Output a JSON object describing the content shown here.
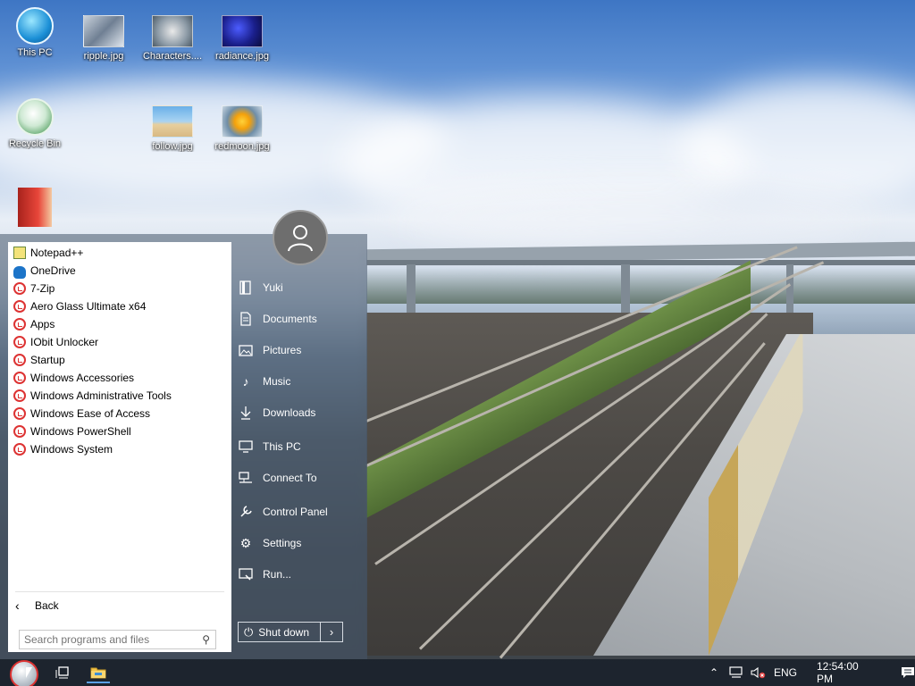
{
  "desktop": {
    "icons": [
      {
        "label": "This PC",
        "icon": "computer-icon"
      },
      {
        "label": "ripple.jpg",
        "icon": "image-file-icon"
      },
      {
        "label": "Characters....",
        "icon": "image-file-icon"
      },
      {
        "label": "radiance.jpg",
        "icon": "image-file-icon"
      },
      {
        "label": "Recycle Bin",
        "icon": "recycle-bin-icon"
      },
      {
        "label": "follow.jpg",
        "icon": "image-file-icon"
      },
      {
        "label": "redmoon.jpg",
        "icon": "image-file-icon"
      },
      {
        "label": "",
        "icon": "book-application-icon"
      }
    ]
  },
  "start_menu": {
    "programs": [
      {
        "label": "Notepad++",
        "icon": "notepad-icon"
      },
      {
        "label": "OneDrive",
        "icon": "onedrive-cloud-icon"
      },
      {
        "label": "7-Zip",
        "icon": "folder-icon"
      },
      {
        "label": "Aero Glass Ultimate x64",
        "icon": "folder-icon"
      },
      {
        "label": "Apps",
        "icon": "folder-icon"
      },
      {
        "label": "IObit Unlocker",
        "icon": "folder-icon"
      },
      {
        "label": "Startup",
        "icon": "folder-icon"
      },
      {
        "label": "Windows Accessories",
        "icon": "folder-icon"
      },
      {
        "label": "Windows Administrative Tools",
        "icon": "folder-icon"
      },
      {
        "label": "Windows Ease of Access",
        "icon": "folder-icon"
      },
      {
        "label": "Windows PowerShell",
        "icon": "folder-icon"
      },
      {
        "label": "Windows System",
        "icon": "folder-icon"
      }
    ],
    "back_label": "Back",
    "search_placeholder": "Search programs and files",
    "places": [
      {
        "label": "Yuki",
        "icon": "user-folder-icon"
      },
      {
        "label": "Documents",
        "icon": "document-icon"
      },
      {
        "label": "Pictures",
        "icon": "picture-icon"
      },
      {
        "label": "Music",
        "icon": "music-note-icon"
      },
      {
        "label": "Downloads",
        "icon": "download-arrow-icon"
      },
      {
        "label": "This PC",
        "icon": "monitor-icon"
      },
      {
        "label": "Connect To",
        "icon": "network-icon"
      },
      {
        "label": "Control Panel",
        "icon": "control-panel-icon"
      },
      {
        "label": "Settings",
        "icon": "gear-icon"
      },
      {
        "label": "Run...",
        "icon": "run-icon"
      }
    ],
    "shutdown_label": "Shut down"
  },
  "taskbar": {
    "language": "ENG",
    "clock": "12:54:00 PM"
  },
  "colors": {
    "folder_icon_red": "#d33333",
    "taskbar_bg": "#141c26"
  }
}
